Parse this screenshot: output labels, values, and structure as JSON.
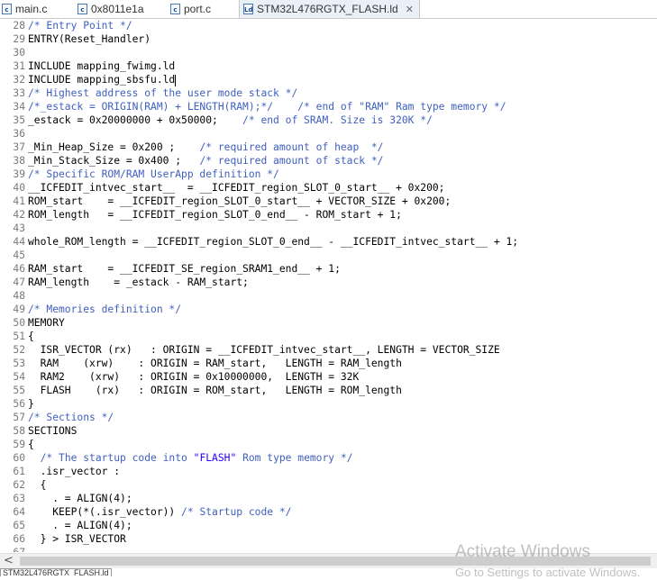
{
  "tabs": [
    {
      "icon": "c-file-icon",
      "icon_text": "c",
      "label": "main.c",
      "active": false
    },
    {
      "icon": "c-file-icon",
      "icon_text": "c",
      "label": "0x8011e1a",
      "active": false
    },
    {
      "icon": "c-file-icon",
      "icon_text": "c",
      "label": "port.c",
      "active": false
    },
    {
      "icon": "ld-file-icon",
      "icon_text": "Ld",
      "label": "STM32L476RGTX_FLASH.ld",
      "active": true,
      "close": "✕"
    }
  ],
  "editor": {
    "lines": [
      {
        "n": "28",
        "parts": [
          {
            "t": "/* Entry Point */",
            "k": "c"
          }
        ]
      },
      {
        "n": "29",
        "parts": [
          {
            "t": "ENTRY(Reset_Handler)",
            "k": ""
          }
        ]
      },
      {
        "n": "30",
        "parts": []
      },
      {
        "n": "31",
        "parts": [
          {
            "t": "INCLUDE mapping_fwimg.ld",
            "k": ""
          }
        ]
      },
      {
        "n": "32",
        "parts": [
          {
            "t": "INCLUDE mapping_sbsfu.ld",
            "k": ""
          }
        ],
        "cursor": true
      },
      {
        "n": "33",
        "parts": [
          {
            "t": "/* Highest address of the user mode stack */",
            "k": "c"
          }
        ]
      },
      {
        "n": "34",
        "parts": [
          {
            "t": "/*_estack = ORIGIN(RAM) + LENGTH(RAM);*/    /* end of \"RAM\" Ram type memory */",
            "k": "c"
          }
        ]
      },
      {
        "n": "35",
        "parts": [
          {
            "t": "_estack = 0x20000000 + 0x50000;    ",
            "k": ""
          },
          {
            "t": "/* end of SRAM. Size is 320K */",
            "k": "c"
          }
        ]
      },
      {
        "n": "36",
        "parts": []
      },
      {
        "n": "37",
        "parts": [
          {
            "t": "_Min_Heap_Size = 0x200 ;    ",
            "k": ""
          },
          {
            "t": "/* required amount of heap  */",
            "k": "c"
          }
        ]
      },
      {
        "n": "38",
        "parts": [
          {
            "t": "_Min_Stack_Size = 0x400 ;   ",
            "k": ""
          },
          {
            "t": "/* required amount of stack */",
            "k": "c"
          }
        ]
      },
      {
        "n": "39",
        "parts": [
          {
            "t": "/* Specific ROM/RAM UserApp definition */",
            "k": "c"
          }
        ]
      },
      {
        "n": "40",
        "parts": [
          {
            "t": "__ICFEDIT_intvec_start__  = __ICFEDIT_region_SLOT_0_start__ + 0x200;",
            "k": ""
          }
        ]
      },
      {
        "n": "41",
        "parts": [
          {
            "t": "ROM_start    = __ICFEDIT_region_SLOT_0_start__ + VECTOR_SIZE + 0x200;",
            "k": ""
          }
        ]
      },
      {
        "n": "42",
        "parts": [
          {
            "t": "ROM_length   = __ICFEDIT_region_SLOT_0_end__ - ROM_start + 1;",
            "k": ""
          }
        ]
      },
      {
        "n": "43",
        "parts": []
      },
      {
        "n": "44",
        "parts": [
          {
            "t": "whole_ROM_length = __ICFEDIT_region_SLOT_0_end__ - __ICFEDIT_intvec_start__ + 1;",
            "k": ""
          }
        ]
      },
      {
        "n": "45",
        "parts": []
      },
      {
        "n": "46",
        "parts": [
          {
            "t": "RAM_start    = __ICFEDIT_SE_region_SRAM1_end__ + 1;",
            "k": ""
          }
        ]
      },
      {
        "n": "47",
        "parts": [
          {
            "t": "RAM_length    = _estack - RAM_start;",
            "k": ""
          }
        ]
      },
      {
        "n": "48",
        "parts": []
      },
      {
        "n": "49",
        "parts": [
          {
            "t": "/* Memories definition */",
            "k": "c"
          }
        ]
      },
      {
        "n": "50",
        "parts": [
          {
            "t": "MEMORY",
            "k": ""
          }
        ]
      },
      {
        "n": "51",
        "parts": [
          {
            "t": "{",
            "k": ""
          }
        ]
      },
      {
        "n": "52",
        "parts": [
          {
            "t": "  ISR_VECTOR (rx)   : ORIGIN = __ICFEDIT_intvec_start__, LENGTH = VECTOR_SIZE",
            "k": ""
          }
        ]
      },
      {
        "n": "53",
        "parts": [
          {
            "t": "  RAM    (xrw)    : ORIGIN = RAM_start,   LENGTH = RAM_length",
            "k": ""
          }
        ]
      },
      {
        "n": "54",
        "parts": [
          {
            "t": "  RAM2    (xrw)   : ORIGIN = 0x10000000,  LENGTH = 32K",
            "k": ""
          }
        ]
      },
      {
        "n": "55",
        "parts": [
          {
            "t": "  FLASH    (rx)   : ORIGIN = ROM_start,   LENGTH = ROM_length",
            "k": ""
          }
        ]
      },
      {
        "n": "56",
        "parts": [
          {
            "t": "}",
            "k": ""
          }
        ]
      },
      {
        "n": "57",
        "parts": [
          {
            "t": "/* Sections */",
            "k": "c"
          }
        ]
      },
      {
        "n": "58",
        "parts": [
          {
            "t": "SECTIONS",
            "k": ""
          }
        ]
      },
      {
        "n": "59",
        "parts": [
          {
            "t": "{",
            "k": ""
          }
        ]
      },
      {
        "n": "60",
        "parts": [
          {
            "t": "  ",
            "k": ""
          },
          {
            "t": "/* The startup code into ",
            "k": "c"
          },
          {
            "t": "\"FLASH\"",
            "k": "s"
          },
          {
            "t": " Rom type memory */",
            "k": "c"
          }
        ]
      },
      {
        "n": "61",
        "parts": [
          {
            "t": "  .isr_vector :",
            "k": ""
          }
        ]
      },
      {
        "n": "62",
        "parts": [
          {
            "t": "  {",
            "k": ""
          }
        ]
      },
      {
        "n": "63",
        "parts": [
          {
            "t": "    . = ALIGN(4);",
            "k": ""
          }
        ]
      },
      {
        "n": "64",
        "parts": [
          {
            "t": "    KEEP(*(.isr_vector)) ",
            "k": ""
          },
          {
            "t": "/* Startup code */",
            "k": "c"
          }
        ]
      },
      {
        "n": "65",
        "parts": [
          {
            "t": "    . = ALIGN(4);",
            "k": ""
          }
        ]
      },
      {
        "n": "66",
        "parts": [
          {
            "t": "  } > ISR_VECTOR",
            "k": ""
          }
        ]
      },
      {
        "n": "67",
        "parts": []
      }
    ]
  },
  "scrollbar": {
    "left_arrow": "<"
  },
  "statusbar": {
    "tab_label": "STM32L476RGTX_FLASH.ld"
  },
  "watermark": {
    "line1": "Activate Windows",
    "line2": "Go to Settings to activate Windows."
  },
  "colors": {
    "comment": "#3f5fbf",
    "string": "#2a00ff",
    "line_number": "#787878"
  }
}
